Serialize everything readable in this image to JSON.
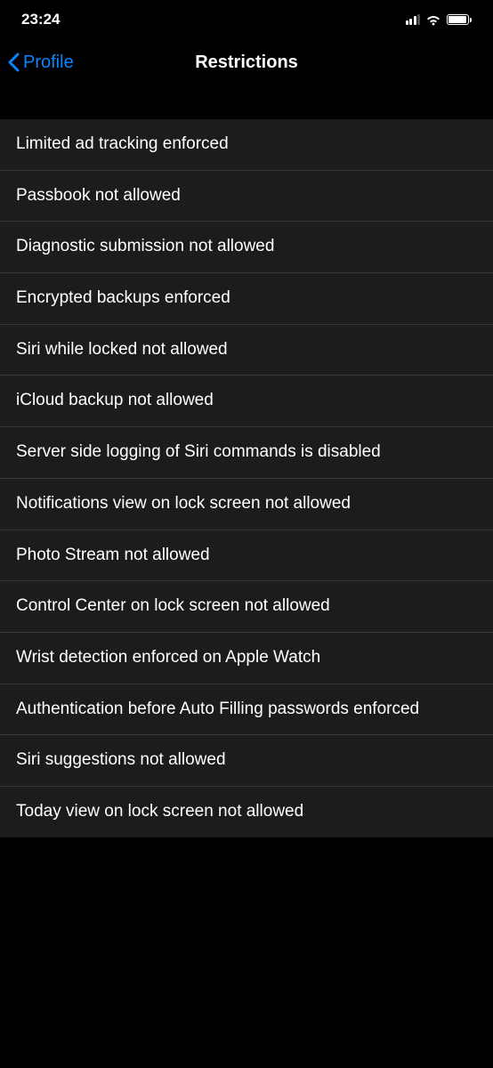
{
  "status_bar": {
    "time": "23:24"
  },
  "nav": {
    "back_label": "Profile",
    "title": "Restrictions"
  },
  "restrictions": [
    "Limited ad tracking enforced",
    "Passbook not allowed",
    "Diagnostic submission not allowed",
    "Encrypted backups enforced",
    "Siri while locked not allowed",
    "iCloud backup not allowed",
    "Server side logging of Siri commands is disabled",
    "Notifications view on lock screen not allowed",
    "Photo Stream not allowed",
    "Control Center on lock screen not allowed",
    "Wrist detection enforced on Apple Watch",
    "Authentication before Auto Filling passwords enforced",
    "Siri suggestions not allowed",
    "Today view on lock screen not allowed"
  ]
}
